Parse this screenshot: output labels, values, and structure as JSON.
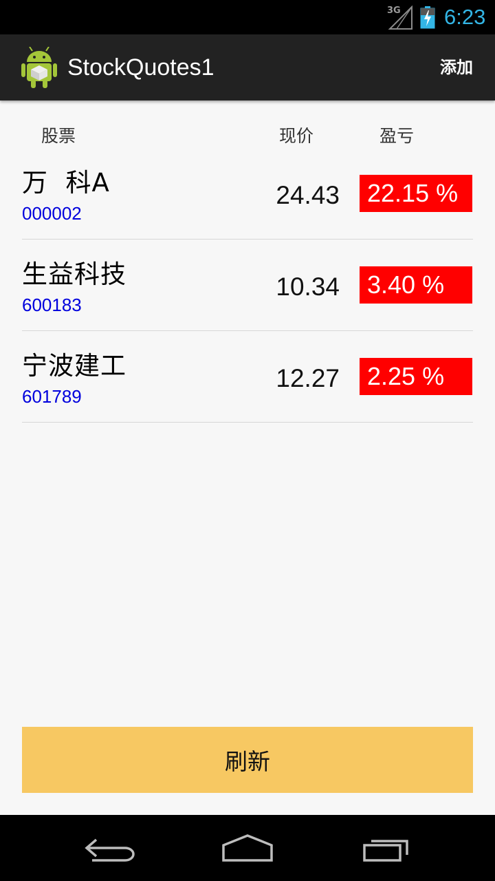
{
  "status_bar": {
    "network": "3G",
    "time": "6:23",
    "accent_color": "#33b5e5"
  },
  "action_bar": {
    "app_icon": "android-robot-icon",
    "title": "StockQuotes1",
    "add_label": "添加"
  },
  "table_header": {
    "stock": "股票",
    "price": "现价",
    "profit_loss": "盈亏"
  },
  "stocks": [
    {
      "name": "万  科A",
      "code": "000002",
      "price": "24.43",
      "profit_loss": "22.15 %"
    },
    {
      "name": "生益科技",
      "code": "600183",
      "price": "10.34",
      "profit_loss": "3.40 %"
    },
    {
      "name": "宁波建工",
      "code": "601789",
      "price": "12.27",
      "profit_loss": "2.25 %"
    }
  ],
  "colors": {
    "profit_bg": "#ff0000",
    "code_text": "#0000dd",
    "refresh_bg": "#f7c862"
  },
  "refresh_label": "刷新",
  "nav_bar": {
    "back_icon": "back-icon",
    "home_icon": "home-icon",
    "recent_icon": "recent-apps-icon"
  }
}
